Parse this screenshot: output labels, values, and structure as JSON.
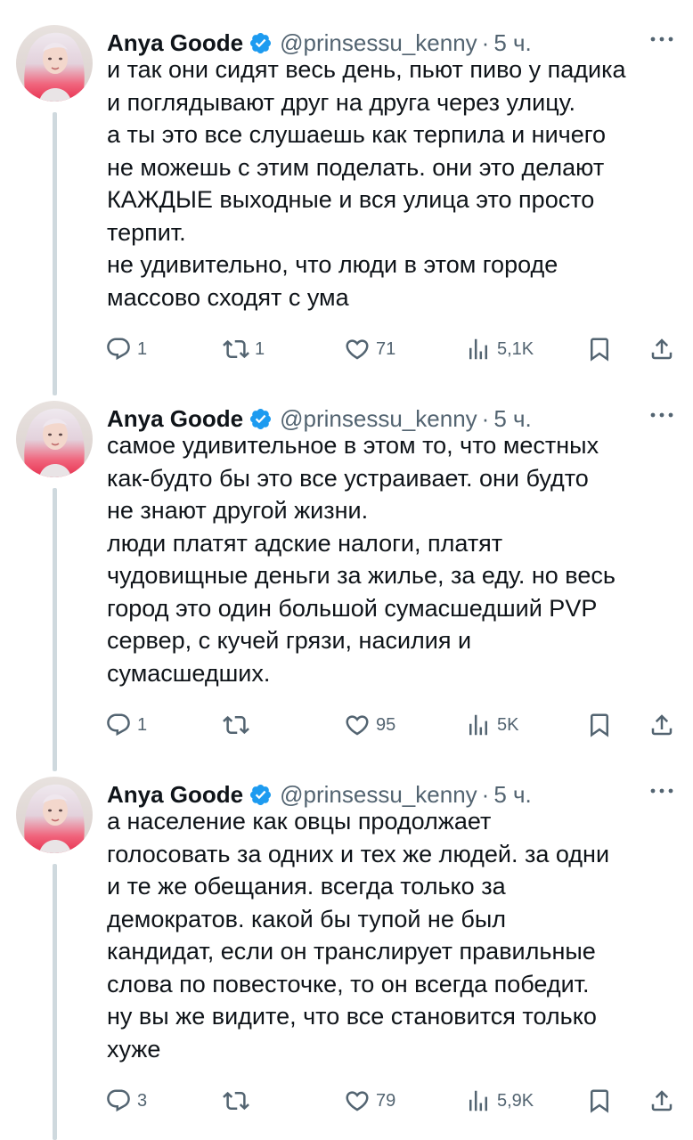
{
  "tweets": [
    {
      "author": "Anya Goode",
      "handle": "@prinsessu_kenny",
      "separator": "·",
      "time": "5 ч.",
      "lines": [
        "и так они сидят весь день, пьют пиво у падика",
        "и поглядывают друг на друга через улицу.",
        "а ты это все слушаешь как терпила и ничего",
        "не можешь с этим поделать. они это делают",
        "КАЖДЫЕ выходные и вся улица это просто",
        "терпит.",
        "не удивительно, что люди в этом городе",
        "массово сходят с ума"
      ],
      "replies": "1",
      "retweets": "1",
      "likes": "71",
      "views": "5,1K"
    },
    {
      "author": "Anya Goode",
      "handle": "@prinsessu_kenny",
      "separator": "·",
      "time": "5 ч.",
      "lines": [
        "самое удивительное в этом то, что местных",
        "как-будто бы это все устраивает. они будто",
        "не знают другой жизни.",
        "люди платят адские налоги, платят",
        "чудовищные деньги за жилье, за еду. но весь",
        "город это один большой сумасшедший PVP",
        "сервер, с кучей грязи, насилия и",
        "сумасшедших."
      ],
      "replies": "1",
      "retweets": "",
      "likes": "95",
      "views": "5K"
    },
    {
      "author": "Anya Goode",
      "handle": "@prinsessu_kenny",
      "separator": "·",
      "time": "5 ч.",
      "lines": [
        "а население как овцы продолжает",
        "голосовать за одних и тех же людей. за одни",
        "и те же обещания. всегда только за",
        "демократов. какой бы тупой не был",
        "кандидат, если он транслирует правильные",
        "слова по повесточке, то он всегда победит.",
        "ну вы же видите, что все становится только",
        "хуже"
      ],
      "replies": "3",
      "retweets": "",
      "likes": "79",
      "views": "5,9K"
    }
  ],
  "icons": {
    "reply": "reply-icon",
    "retweet": "retweet-icon",
    "like": "heart-icon",
    "views": "views-chart-icon",
    "bookmark": "bookmark-icon",
    "share": "share-icon",
    "more": "more-dots-icon",
    "verified": "verified-badge-icon"
  },
  "colors": {
    "text": "#0f1419",
    "secondary": "#536471",
    "verified": "#1d9bf0",
    "thread_line": "#cfd9de"
  }
}
